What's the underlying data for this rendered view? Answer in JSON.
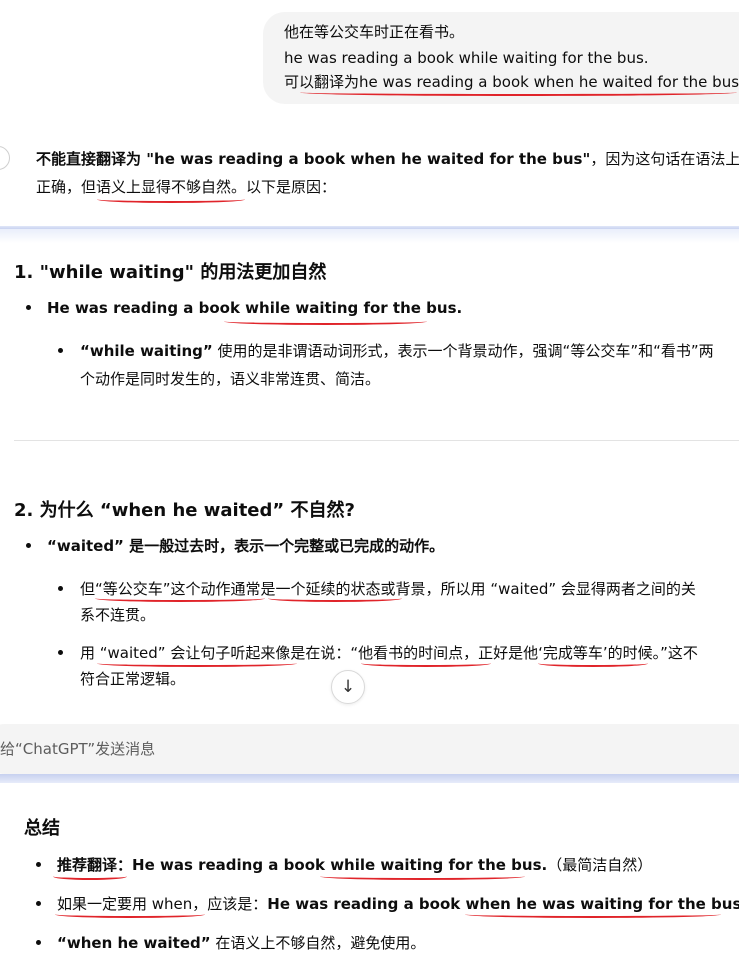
{
  "user_message": {
    "line1": "他在等公交车时正在看书。",
    "line2": "he was reading a book while waiting for the bus.",
    "line3": "可以翻译为he was reading a book when he waited for the bus."
  },
  "reply": {
    "intro_bold": "不能直接翻译为 \"he was reading a book when he waited for the bus\"",
    "intro_rest1": "，因为这句话在语法上虽然",
    "intro_line2": "正确，但语义上显得不够自然。以下是原因：",
    "section1": {
      "title": "1. \"while waiting\" 的用法更加自然",
      "bullet1": "He was reading a book while waiting for the bus.",
      "sub1_bold": "“while waiting”",
      "sub1_line1_rest": " 使用的是非谓语动词形式，表示一个背景动作，强调“等公交车”和“看书”两",
      "sub1_line2": "个动作是同时发生的，语义非常连贯、简洁。"
    },
    "section2": {
      "title": "2. 为什么 “when he waited” 不自然?",
      "bullet1": "“waited” 是一般过去时，表示一个完整或已完成的动作。",
      "sub1_line1": "但“等公交车”这个动作通常是一个延续的状态或背景，所以用 “waited” 会显得两者之间的关",
      "sub1_line2": "系不连贯。",
      "sub2_line1": "用 “waited” 会让句子听起来像是在说：“他看书的时间点，正好是他‘完成等车’的时候。”这不",
      "sub2_line2": "符合正常逻辑。"
    },
    "summary": {
      "title": "总结",
      "b1_label": "推荐翻译：",
      "b1_sentence": "He was reading a book while waiting for the bus.",
      "b1_note": "（最简洁自然）",
      "b2_prefix": "如果一定要用 when，应该是：",
      "b2_sentence": "He was reading a book when he was waiting for the bus.",
      "b3_bold": "“when he waited”",
      "b3_rest": " 在语义上不够自然，避免使用。"
    }
  },
  "composer": {
    "placeholder": "给“ChatGPT”发送消息"
  },
  "scroll_down_icon": "arrow-down-icon",
  "colors": {
    "underline": "#e0242a",
    "bubble": "#f4f4f4",
    "accent_band": "#c9d3f0"
  }
}
